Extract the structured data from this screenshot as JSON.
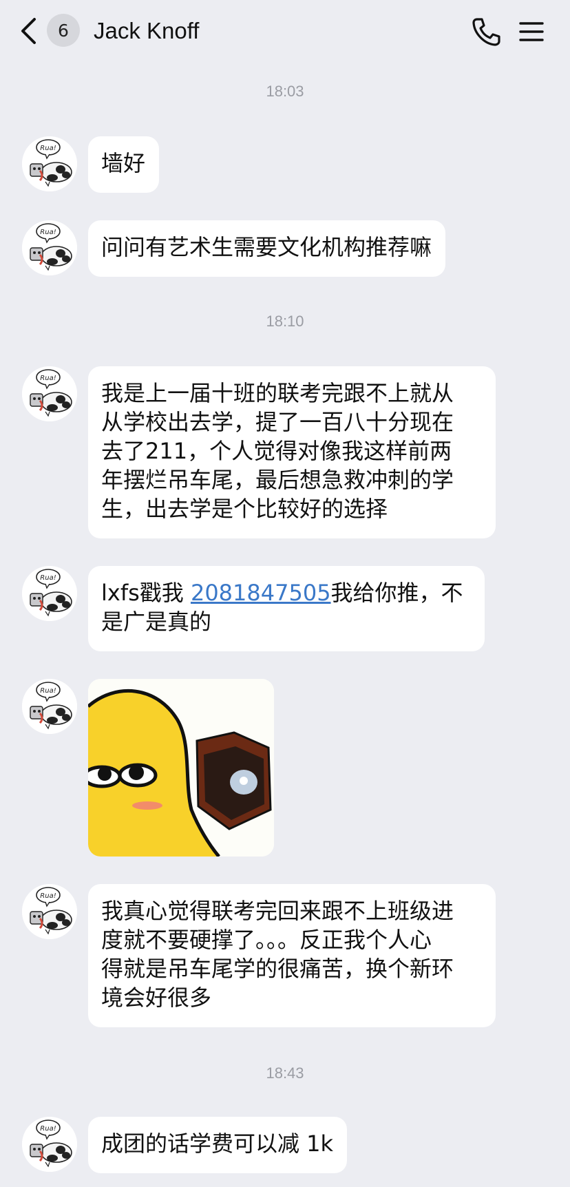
{
  "header": {
    "back_icon": "chevron-left-icon",
    "unread_count": "6",
    "title": "Jack Knoff",
    "call_icon": "phone-icon",
    "menu_icon": "menu-icon"
  },
  "timestamps": [
    "18:03",
    "18:10",
    "18:43"
  ],
  "messages": [
    {
      "type": "text",
      "text": "墙好"
    },
    {
      "type": "text",
      "text": "问问有艺术生需要文化机构推荐嘛"
    },
    {
      "type": "text",
      "lines": [
        "我是上一届十班的联考完跟不上就从",
        "从学校出去学，提了一百八十分现在",
        "去了211，个人觉得对像我这样前两",
        "年摆烂吊车尾，最后想急救冲刺的学",
        "生，出去学是个比较好的选择"
      ]
    },
    {
      "type": "text",
      "prefix": "lxfs戳我 ",
      "link": "2081847505",
      "suffix_line1": "我给你推，不",
      "line2": "是广是真的"
    },
    {
      "type": "image",
      "description": "sticker-image"
    },
    {
      "type": "text",
      "lines": [
        "我真心觉得联考完回来跟不上班级进",
        "度就不要硬撑了。。。反正我个人心",
        "得就是吊车尾学的很痛苦，换个新环",
        "境会好很多"
      ]
    },
    {
      "type": "text",
      "text": "成团的话学费可以减 1k"
    }
  ],
  "avatar_text": "Rua!",
  "colors": {
    "background": "#ecedf2",
    "bubble": "#ffffff",
    "link": "#3a78c8",
    "timestamp": "#9a9ca3"
  }
}
